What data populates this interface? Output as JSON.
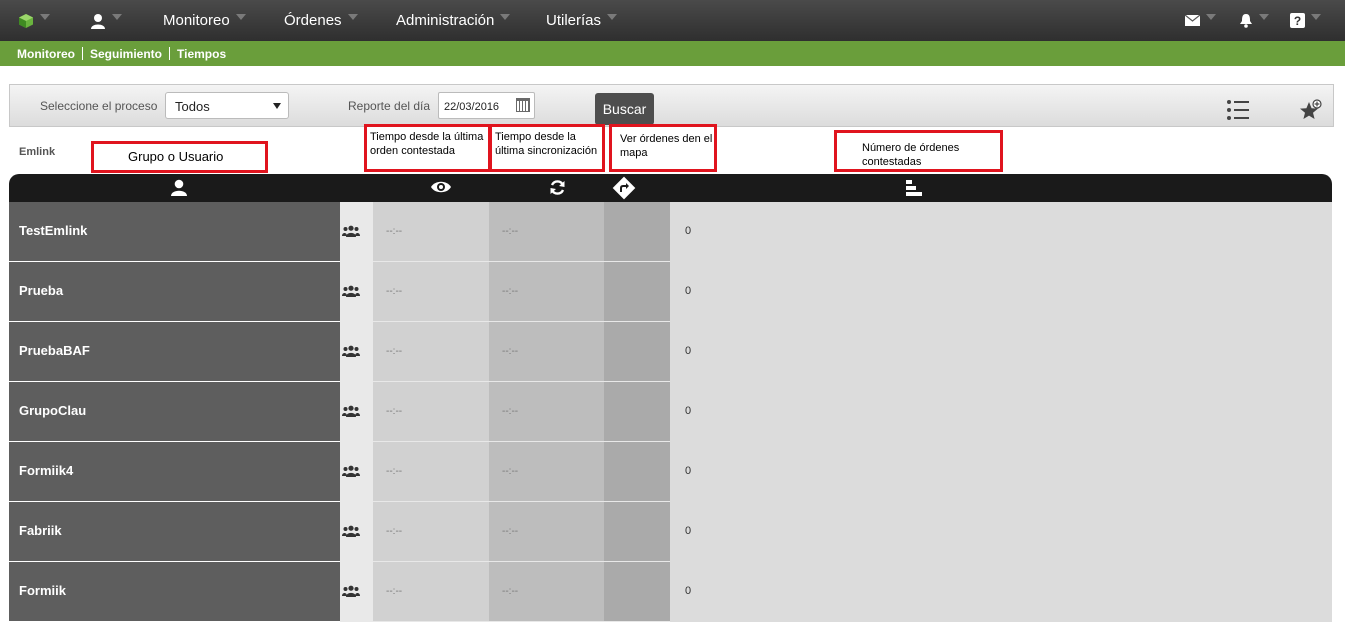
{
  "topbar": {
    "nav": [
      "Monitoreo",
      "Órdenes",
      "Administración",
      "Utilerías"
    ],
    "icons": [
      "app-logo-icon",
      "user-icon",
      "mail-icon",
      "bell-icon",
      "help-icon"
    ]
  },
  "breadcrumb": [
    "Monitoreo",
    "Seguimiento",
    "Tiempos"
  ],
  "filters": {
    "process_label": "Seleccione el proceso",
    "process_value": "Todos",
    "report_label": "Reporte del día",
    "report_date": "22/03/2016",
    "search_button": "Buscar"
  },
  "annotations": {
    "group_user": "Grupo o Usuario",
    "time_last_order": "Tiempo desde la última orden contestada",
    "time_last_sync": "Tiempo desde la última sincronización",
    "view_map": "Ver órdenes den el mapa",
    "num_orders": "Número de órdenes contestadas"
  },
  "section_label": "Emlink",
  "table": {
    "header_icons": [
      "user-icon",
      "eye-icon",
      "refresh-icon",
      "route-icon",
      "bar-chart-icon"
    ],
    "rows": [
      {
        "name": "TestEmlink",
        "t1": "--:--",
        "t2": "--:--",
        "count": "0"
      },
      {
        "name": "Prueba",
        "t1": "--:--",
        "t2": "--:--",
        "count": "0"
      },
      {
        "name": "PruebaBAF",
        "t1": "--:--",
        "t2": "--:--",
        "count": "0"
      },
      {
        "name": "GrupoClau",
        "t1": "--:--",
        "t2": "--:--",
        "count": "0"
      },
      {
        "name": "Formiik4",
        "t1": "--:--",
        "t2": "--:--",
        "count": "0"
      },
      {
        "name": "Fabriik",
        "t1": "--:--",
        "t2": "--:--",
        "count": "0"
      },
      {
        "name": "Formiik",
        "t1": "--:--",
        "t2": "--:--",
        "count": "0"
      }
    ]
  },
  "colors": {
    "topbar": "#3a3a3a",
    "breadcrumb": "#6a9e3b",
    "annotation_border": "#e0141e",
    "name_cell": "#5e5e5e"
  }
}
